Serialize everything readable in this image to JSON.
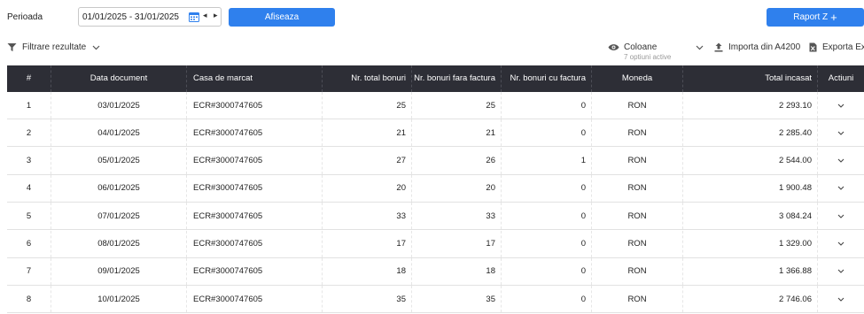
{
  "period": {
    "label": "Perioada",
    "value": "01/01/2025 - 31/01/2025"
  },
  "buttons": {
    "show": "Afiseaza",
    "report": "Raport Z"
  },
  "toolbar": {
    "filter": "Filtrare rezultate",
    "columns": "Coloane",
    "columns_sub": "7 optiuni active",
    "import": "Importa din A4200",
    "export": "Exporta Excel"
  },
  "colors": {
    "primary": "#2f80ed",
    "header_bg": "#2d2e36"
  },
  "table": {
    "headers": [
      "#",
      "Data document",
      "Casa de marcat",
      "Nr. total bonuri",
      "Nr. bonuri fara factura",
      "Nr. bonuri cu factura",
      "Moneda",
      "Total incasat",
      "Actiuni"
    ],
    "rows": [
      [
        "1",
        "03/01/2025",
        "ECR#3000747605",
        "25",
        "25",
        "0",
        "RON",
        "2 293.10"
      ],
      [
        "2",
        "04/01/2025",
        "ECR#3000747605",
        "21",
        "21",
        "0",
        "RON",
        "2 285.40"
      ],
      [
        "3",
        "05/01/2025",
        "ECR#3000747605",
        "27",
        "26",
        "1",
        "RON",
        "2 544.00"
      ],
      [
        "4",
        "06/01/2025",
        "ECR#3000747605",
        "20",
        "20",
        "0",
        "RON",
        "1 900.48"
      ],
      [
        "5",
        "07/01/2025",
        "ECR#3000747605",
        "33",
        "33",
        "0",
        "RON",
        "3 084.24"
      ],
      [
        "6",
        "08/01/2025",
        "ECR#3000747605",
        "17",
        "17",
        "0",
        "RON",
        "1 329.00"
      ],
      [
        "7",
        "09/01/2025",
        "ECR#3000747605",
        "18",
        "18",
        "0",
        "RON",
        "1 366.88"
      ],
      [
        "8",
        "10/01/2025",
        "ECR#3000747605",
        "35",
        "35",
        "0",
        "RON",
        "2 746.06"
      ]
    ]
  }
}
